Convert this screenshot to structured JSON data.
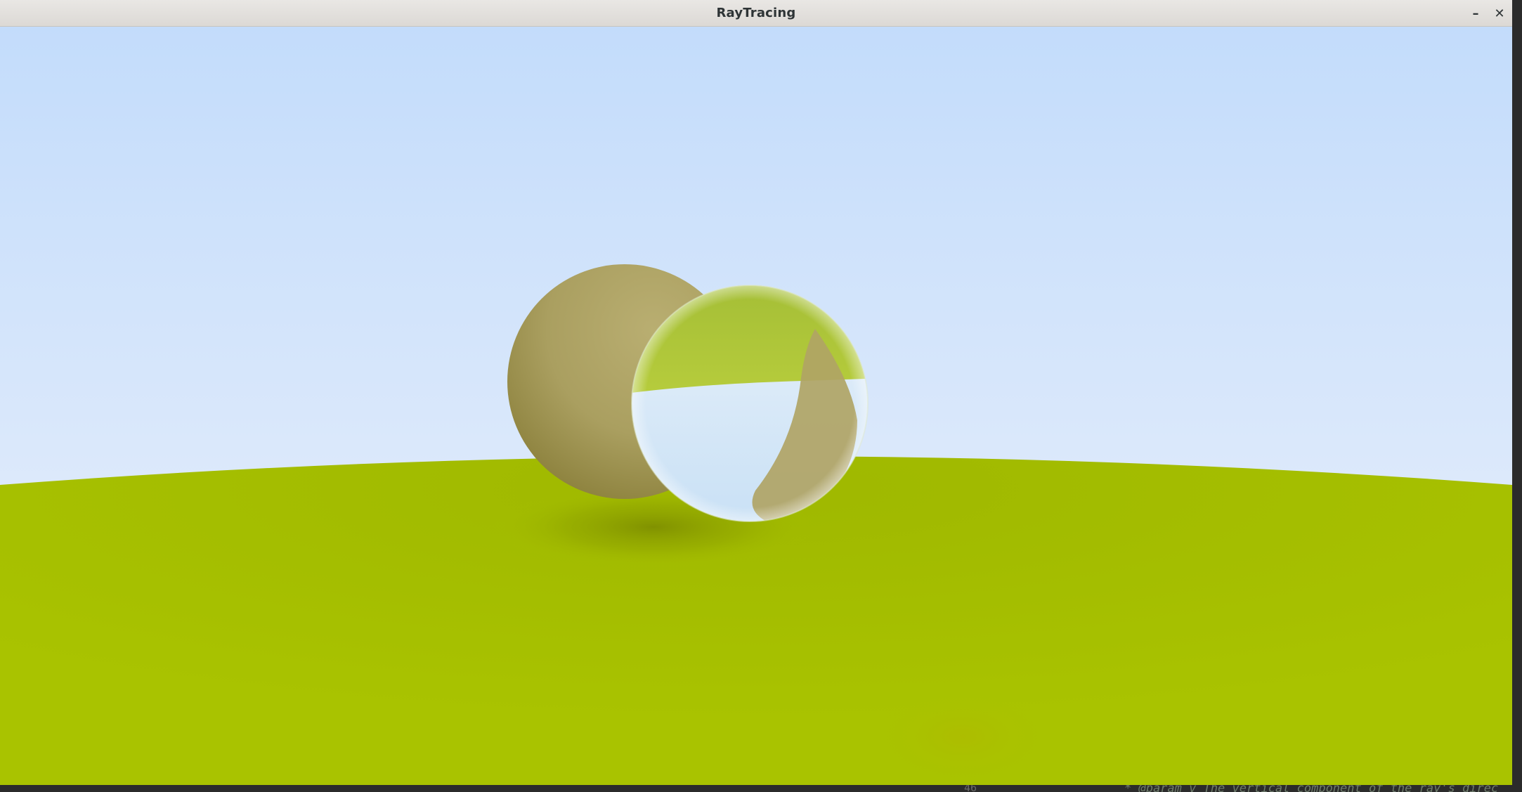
{
  "window": {
    "title": "RayTracing",
    "minimize_symbol": "–",
    "close_symbol": "✕"
  },
  "background_peek": {
    "line_number": "46",
    "code_text": "* @param v The vertical component of the ray's direc"
  },
  "scene": {
    "sky_top": "#c3dcfb",
    "sky_horizon": "#e6f0fb",
    "ground_color": "#a8c200",
    "matte_sphere_color": "#b3a96c",
    "glass_tint": "#a9c324"
  }
}
